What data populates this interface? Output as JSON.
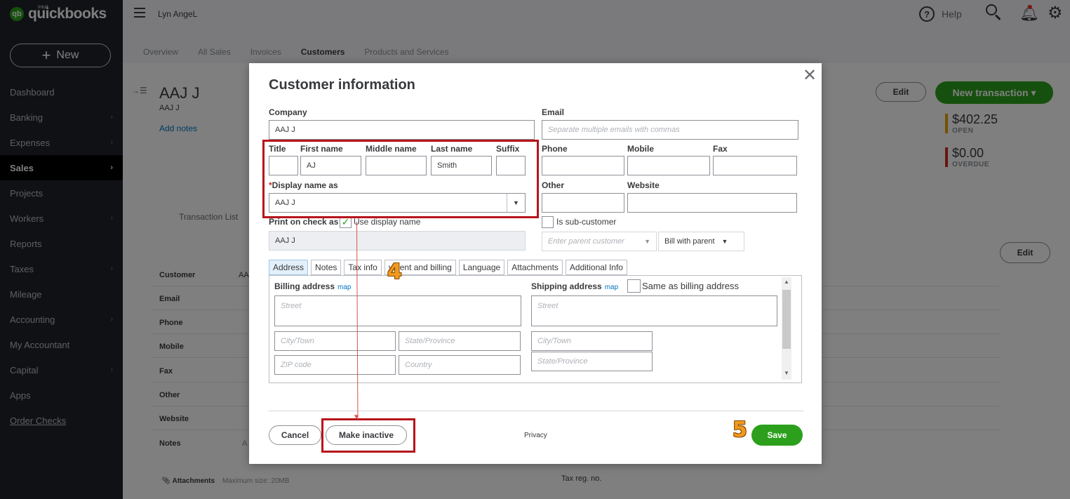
{
  "app": {
    "logo_intuit": "intuit",
    "logo_text": "quickbooks",
    "logo_mark": "qb",
    "company_name": "Lyn AngeL",
    "help_label": "Help"
  },
  "sidebar": {
    "new_label": "New",
    "items": [
      {
        "label": "Dashboard",
        "chevron": false
      },
      {
        "label": "Banking",
        "chevron": true
      },
      {
        "label": "Expenses",
        "chevron": true
      },
      {
        "label": "Sales",
        "chevron": true,
        "active": true
      },
      {
        "label": "Projects",
        "chevron": false
      },
      {
        "label": "Workers",
        "chevron": true
      },
      {
        "label": "Reports",
        "chevron": false
      },
      {
        "label": "Taxes",
        "chevron": true
      },
      {
        "label": "Mileage",
        "chevron": false
      },
      {
        "label": "Accounting",
        "chevron": true
      },
      {
        "label": "My Accountant",
        "chevron": false
      },
      {
        "label": "Capital",
        "chevron": true
      },
      {
        "label": "Apps",
        "chevron": false
      },
      {
        "label": "Order Checks",
        "chevron": false
      }
    ]
  },
  "subtabs": [
    "Overview",
    "All Sales",
    "Invoices",
    "Customers",
    "Products and Services"
  ],
  "background": {
    "customer_name": "AAJ J",
    "customer_sub": "AAJ J",
    "add_notes": "Add notes",
    "transaction_list": "Transaction List",
    "edit_label": "Edit",
    "new_transaction_label": "New transaction ▾",
    "open_amount": "$402.25",
    "open_label": "OPEN",
    "overdue_amount": "$0.00",
    "overdue_label": "OVERDUE",
    "fields": [
      "Customer",
      "Email",
      "Phone",
      "Mobile",
      "Fax",
      "Other",
      "Website",
      "Notes"
    ],
    "customer_value_fragment": "AA",
    "notes_value_fragment": "A",
    "attachments_label": "Attachments",
    "attachments_max": "Maximum size: 20MB",
    "tax_reg": "Tax reg. no."
  },
  "modal": {
    "title": "Customer information",
    "company_label": "Company",
    "company_value": "AAJ J",
    "email_label": "Email",
    "email_placeholder": "Separate multiple emails with commas",
    "title_label": "Title",
    "first_name_label": "First name",
    "first_name_value": "AJ",
    "middle_name_label": "Middle name",
    "last_name_label": "Last name",
    "last_name_value": "Smith",
    "suffix_label": "Suffix",
    "phone_label": "Phone",
    "mobile_label": "Mobile",
    "fax_label": "Fax",
    "display_name_label": "Display name as",
    "display_name_value": "AAJ J",
    "other_label": "Other",
    "website_label": "Website",
    "print_on_check_label": "Print on check as",
    "use_display_name_label": "Use display name",
    "print_on_check_value": "AAJ J",
    "sub_customer_label": "Is sub-customer",
    "parent_placeholder": "Enter parent customer",
    "bill_with_parent": "Bill with parent",
    "tabs": [
      "Address",
      "Notes",
      "Tax info",
      "Payment and billing",
      "Language",
      "Attachments",
      "Additional Info"
    ],
    "tab_payment_visible": "yment and billing",
    "billing_label": "Billing address",
    "map_label": "map",
    "shipping_label": "Shipping address",
    "same_as_billing": "Same as billing address",
    "street_ph": "Street",
    "city_ph": "City/Town",
    "state_ph": "State/Province",
    "zip_ph": "ZIP code",
    "country_ph": "Country",
    "cancel_label": "Cancel",
    "make_inactive_label": "Make inactive",
    "privacy_label": "Privacy",
    "save_label": "Save"
  },
  "annotations": {
    "step4": "4",
    "step5": "5"
  }
}
